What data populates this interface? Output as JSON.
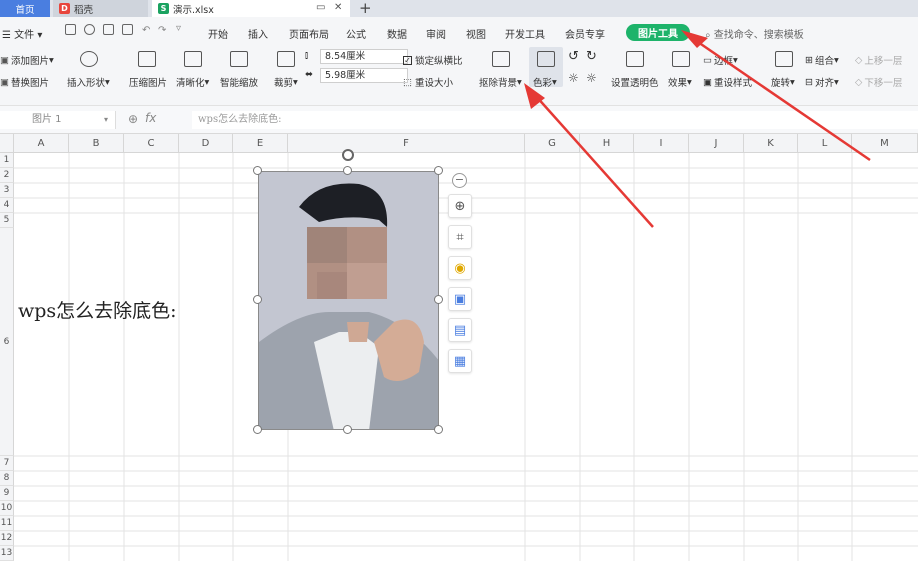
{
  "tabs": {
    "home": "首页",
    "docer": "稻壳",
    "doc": "演示.xlsx",
    "new_tab": "+"
  },
  "menu": {
    "file": "文件",
    "items": [
      "开始",
      "插入",
      "页面布局",
      "公式",
      "数据",
      "审阅",
      "视图",
      "开发工具",
      "会员专享"
    ],
    "picture_tools": "图片工具",
    "search": "查找命令、搜索模板"
  },
  "ribbon": {
    "add_picture": "添加图片",
    "replace_picture": "替换图片",
    "insert_shape": "插入形状",
    "compress": "压缩图片",
    "sharpen": "清晰化",
    "smart_zoom": "智能缩放",
    "crop": "裁剪",
    "height": "8.54厘米",
    "width": "5.98厘米",
    "lock_ratio": "锁定纵横比",
    "reset_size": "重设大小",
    "remove_bg": "抠除背景",
    "color": "色彩",
    "transparent": "设置透明色",
    "effects": "效果",
    "border": "边框",
    "reset_style": "重设样式",
    "rotate": "旋转",
    "group": "组合",
    "align": "对齐",
    "bring_forward": "上移一层",
    "send_backward": "下移一层"
  },
  "formula": {
    "name_box": "图片 1",
    "fx": "fx",
    "content": "wps怎么去除底色:"
  },
  "columns": [
    "A",
    "B",
    "C",
    "D",
    "E",
    "F",
    "G",
    "H",
    "I",
    "J",
    "K",
    "L",
    "M"
  ],
  "rows": [
    "1",
    "2",
    "3",
    "4",
    "5",
    "6",
    "7",
    "8",
    "9",
    "10",
    "11",
    "12",
    "13"
  ],
  "cell_text": "wps怎么去除底色:",
  "colors": {
    "accent_green": "#1db36a",
    "arrow_red": "#e53935",
    "tab_blue": "#4a7ee0"
  }
}
